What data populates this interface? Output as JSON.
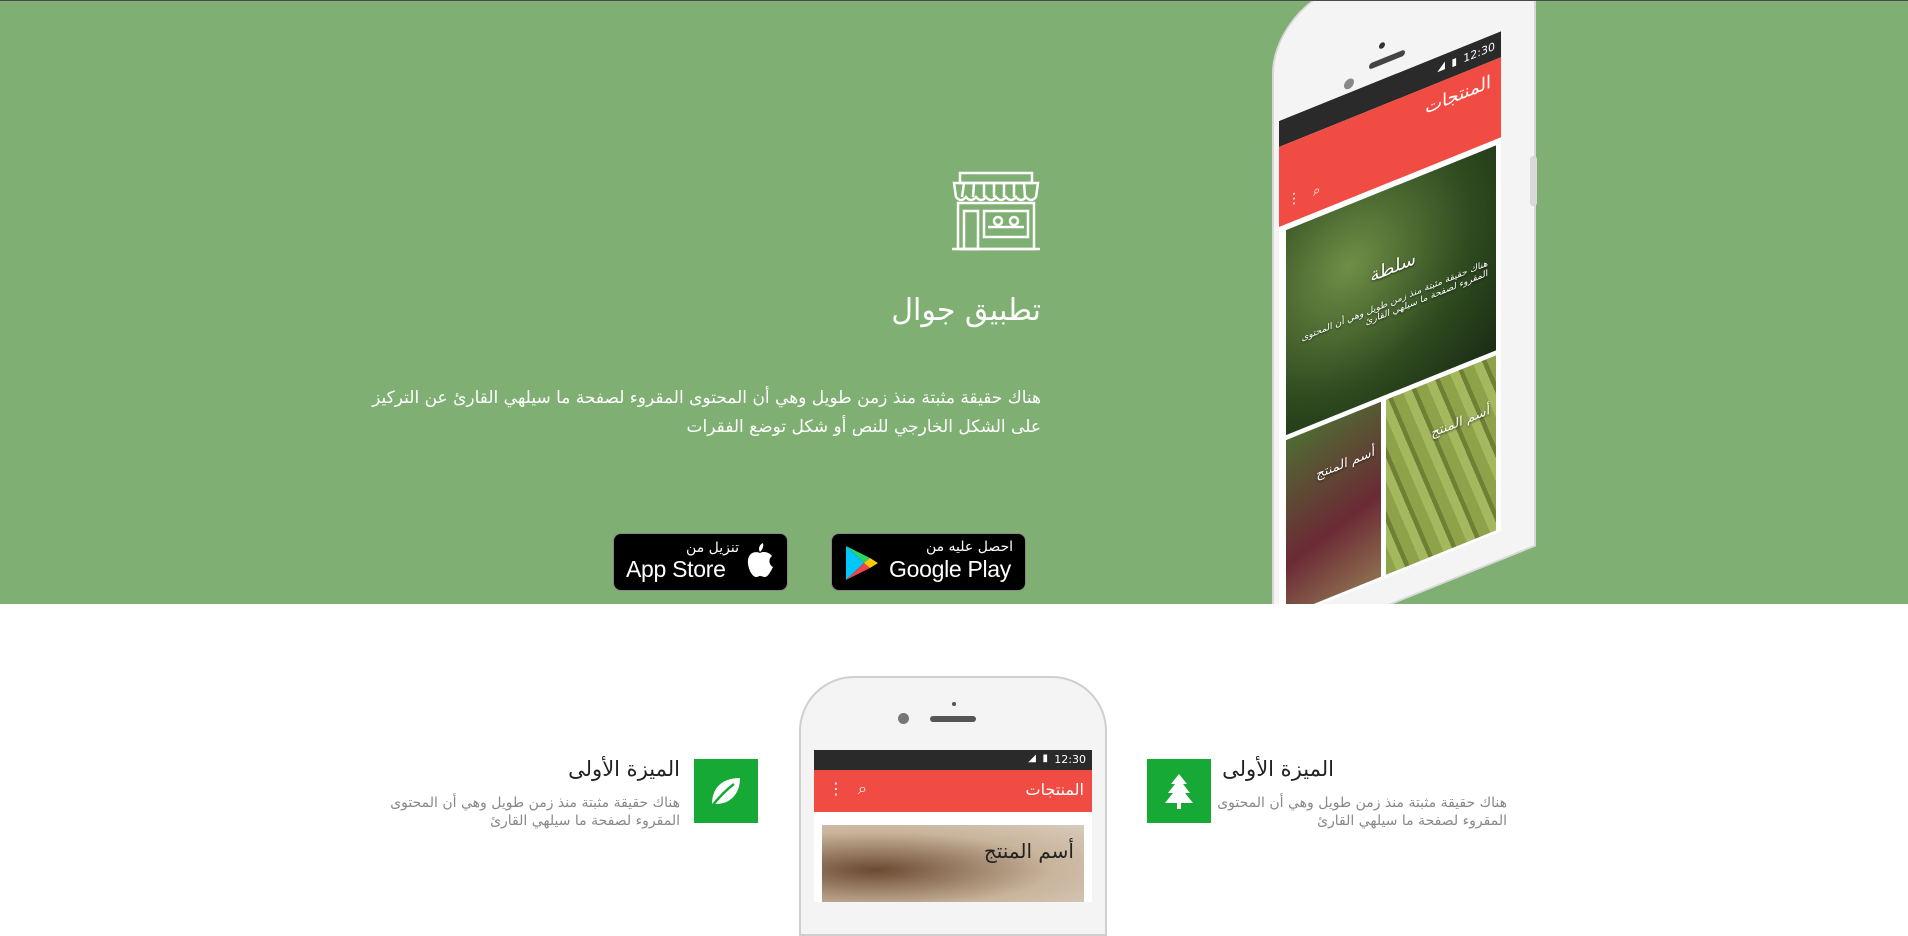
{
  "hero": {
    "title": "تطبيق جوال",
    "description": "هناك حقيقة مثبتة منذ زمن طويل وهي أن المحتوى المقروء لصفحة ما سيلهي القارئ عن التركيز على الشكل الخارجي للنص أو شكل توضع الفقرات",
    "google_play": {
      "small": "احصل عليه من",
      "big": "Google Play"
    },
    "app_store": {
      "small": "تنزيل من",
      "big": "App Store"
    },
    "background_color": "#7faf72"
  },
  "phone_large": {
    "time": "12:30",
    "toolbar_title": "المنتجات",
    "main_item_title": "سلطة",
    "main_item_desc": "هناك حقيقة مثبتة منذ زمن طويل وهي أن المحتوى المقروء لصفحة ما سيلهي القارئ",
    "item_a": "أسم المنتج",
    "item_b": "أسم المنتج"
  },
  "phone_small": {
    "time": "12:30",
    "toolbar_title": "المنتجات",
    "item_title": "أسم المنتج"
  },
  "features": [
    {
      "title": "الميزة الأولى",
      "desc": "هناك حقيقة مثبتة منذ زمن طويل وهي أن المحتوى المقروء لصفحة ما سيلهي القارئ",
      "icon": "tree-icon"
    },
    {
      "title": "الميزة الأولى",
      "desc": "هناك حقيقة مثبتة منذ زمن طويل وهي أن المحتوى المقروء لصفحة ما سيلهي القارئ",
      "icon": "leaf-icon"
    }
  ],
  "accent_color": "#f14c43",
  "feature_color": "#16a935"
}
